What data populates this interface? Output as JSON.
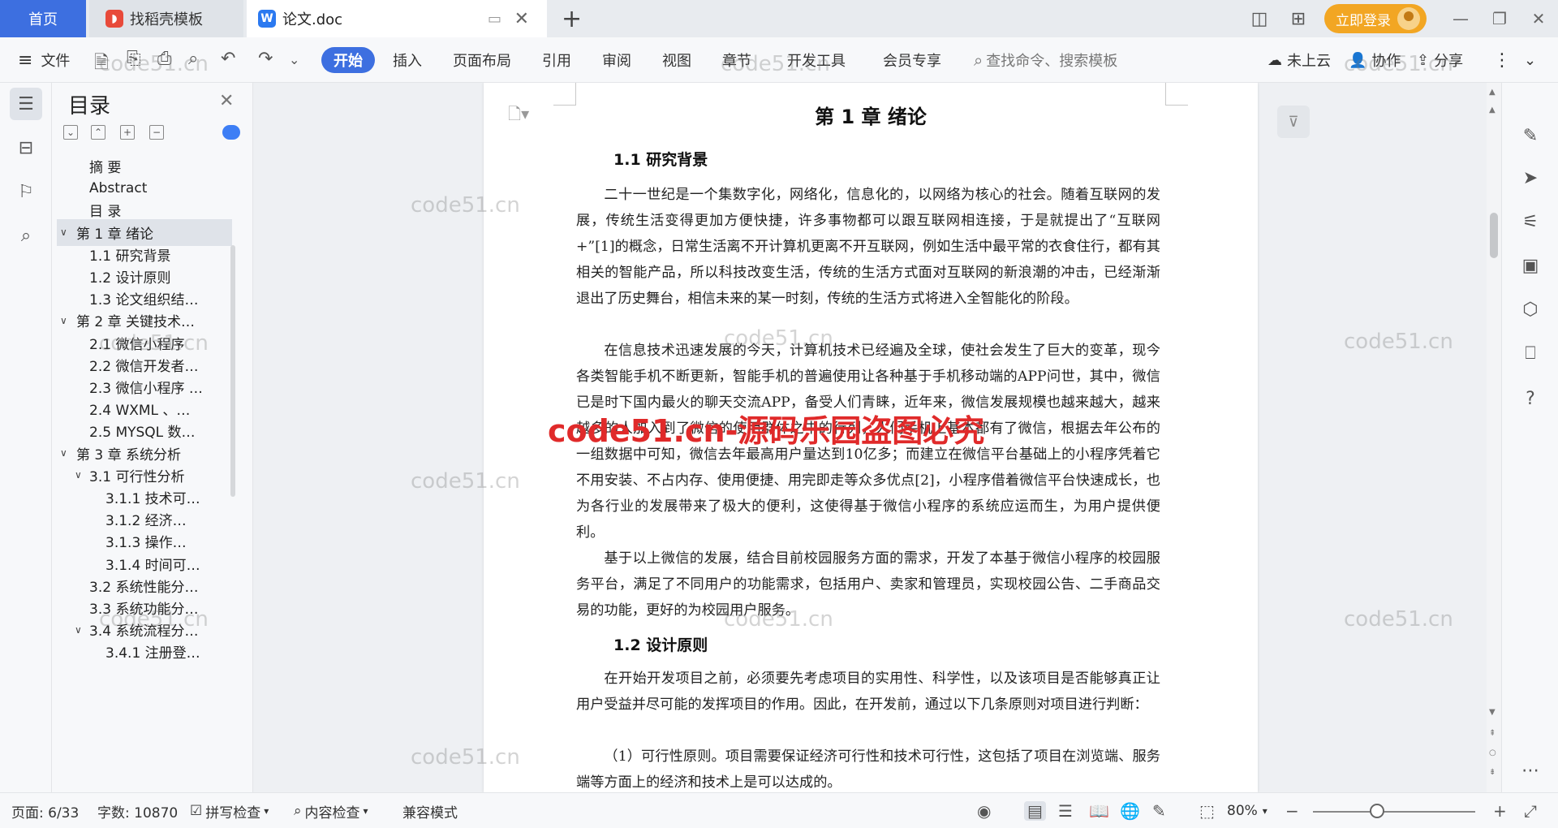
{
  "tabs": {
    "home": "首页",
    "template": "找稻壳模板",
    "document": "论文.doc"
  },
  "topbar": {
    "login": "立即登录"
  },
  "ribbon": {
    "file": "文件",
    "menus": [
      "开始",
      "插入",
      "页面布局",
      "引用",
      "审阅",
      "视图",
      "章节",
      "开发工具",
      "会员专享"
    ],
    "search_placeholder": "查找命令、搜索模板",
    "cloud": "未上云",
    "collab": "协作",
    "share": "分享"
  },
  "toc": {
    "title": "目录",
    "items": [
      {
        "label": "摘  要",
        "level": 0
      },
      {
        "label": "Abstract",
        "level": 0
      },
      {
        "label": "目    录",
        "level": 0
      },
      {
        "label": "第 1 章   绪论",
        "level": 1
      },
      {
        "label": "1.1 研究背景",
        "level": 2
      },
      {
        "label": "1.2 设计原则",
        "level": 2
      },
      {
        "label": "1.3 论文组织结…",
        "level": 2
      },
      {
        "label": "第 2 章   关键技术…",
        "level": 1
      },
      {
        "label": "2.1  微信小程序",
        "level": 2
      },
      {
        "label": "2.2  微信开发者…",
        "level": 2
      },
      {
        "label": "2.3 微信小程序 …",
        "level": 2
      },
      {
        "label": "2.4 WXML  、…",
        "level": 2
      },
      {
        "label": "2.5 MYSQL 数…",
        "level": 2
      },
      {
        "label": "第 3 章   系统分析",
        "level": 1
      },
      {
        "label": "3.1  可行性分析",
        "level": 2
      },
      {
        "label": "3.1.1 技术可…",
        "level": 3
      },
      {
        "label": "3.1.2  经济…",
        "level": 3
      },
      {
        "label": "3.1.3  操作…",
        "level": 3
      },
      {
        "label": "3.1.4 时间可…",
        "level": 3
      },
      {
        "label": "3.2  系统性能分…",
        "level": 2
      },
      {
        "label": "3.3  系统功能分…",
        "level": 2
      },
      {
        "label": "3.4  系统流程分…",
        "level": 2
      },
      {
        "label": "3.4.1 注册登…",
        "level": 3
      }
    ]
  },
  "document": {
    "chapter_title": "第 1 章    绪论",
    "section1_title": "1.1 研究背景",
    "p1": "二十一世纪是一个集数字化，网络化，信息化的，以网络为核心的社会。随着互联网的发展，传统生活变得更加方便快捷，许多事物都可以跟互联网相连接，于是就提出了“互联网+”[1]的概念，日常生活离不开计算机更离不开互联网，例如生活中最平常的衣食住行，都有其相关的智能产品，所以科技改变生活，传统的生活方式面对互联网的新浪潮的冲击，已经渐渐退出了历史舞台，相信未来的某一时刻，传统的生活方式将进入全智能化的阶段。",
    "p2": "在信息技术迅速发展的今天，计算机技术已经遍及全球，使社会发生了巨大的变革，现今各类智能手机不断更新，智能手机的普遍使用让各种基于手机移动端的APP问世，其中，微信已是时下国内最火的聊天交流APP，备受人们青睐，近年来，微信发展规模也越来越大，越来越多的人加入到了微信的使用群体之中的行列，人们手机上基本都有了微信，根据去年公布的一组数据中可知，微信去年最高用户量达到10亿多；而建立在微信平台基础上的小程序凭着它不用安装、不占内存、使用便捷、用完即走等众多优点[2]，小程序借着微信平台快速成长，也为各行业的发展带来了极大的便利，这使得基于微信小程序的系统应运而生，为用户提供便利。",
    "p3": "基于以上微信的发展，结合目前校园服务方面的需求，开发了本基于微信小程序的校园服务平台，满足了不同用户的功能需求，包括用户、卖家和管理员，实现校园公告、二手商品交易的功能，更好的为校园用户服务。",
    "section2_title": "1.2 设计原则",
    "p4": "在开始开发项目之前，必须要先考虑项目的实用性、科学性，以及该项目是否能够真正让用户受益并尽可能的发挥项目的作用。因此，在开发前，通过以下几条原则对项目进行判断：",
    "p5": "（1）可行性原则。项目需要保证经济可行性和技术可行性，这包括了项目在浏览端、服务端等方面上的经济和技术上是可以达成的。"
  },
  "watermarks": {
    "gray": "code51.cn",
    "red": "code51.cn-源码乐园盗图必究"
  },
  "status": {
    "page": "页面: 6/33",
    "words": "字数: 10870",
    "spell": "拼写检查",
    "content_check": "内容检查",
    "compat": "兼容模式",
    "zoom": "80%"
  }
}
